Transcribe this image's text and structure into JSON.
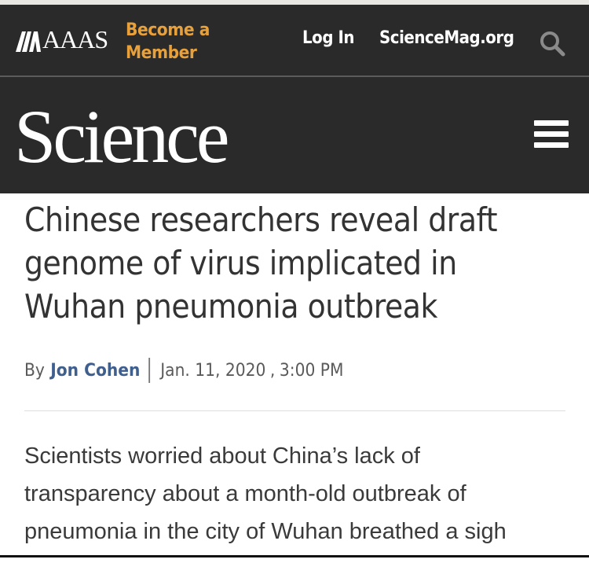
{
  "header": {
    "org_logo_text": "AAAS",
    "become_member_line1": "Become a",
    "become_member_line2": "Member",
    "login_label": "Log In",
    "site_link_label": "ScienceMag.org"
  },
  "masthead": {
    "logo_text": "Science"
  },
  "article": {
    "headline_line1": "Chinese researchers reveal draft",
    "headline_line2": "genome of virus implicated in",
    "headline_line3": "Wuhan pneumonia outbreak",
    "by_prefix": "By",
    "author": "Jon Cohen",
    "date": "Jan. 11, 2020",
    "date_separator": ",",
    "time": "3:00 PM",
    "body_line1": "Scientists worried about China’s lack of",
    "body_line2": "transparency about a month-old outbreak of",
    "body_line3": "pneumonia in the city of Wuhan breathed a sigh"
  },
  "icons": {
    "search": "search-icon",
    "menu": "hamburger-menu-icon",
    "aaas_mark": "aaas-logo-mark"
  },
  "colors": {
    "header_bg": "#2a2a2a",
    "member_accent": "#e8a13a",
    "author_link": "#3f5f8f",
    "headline_text": "#333333"
  }
}
